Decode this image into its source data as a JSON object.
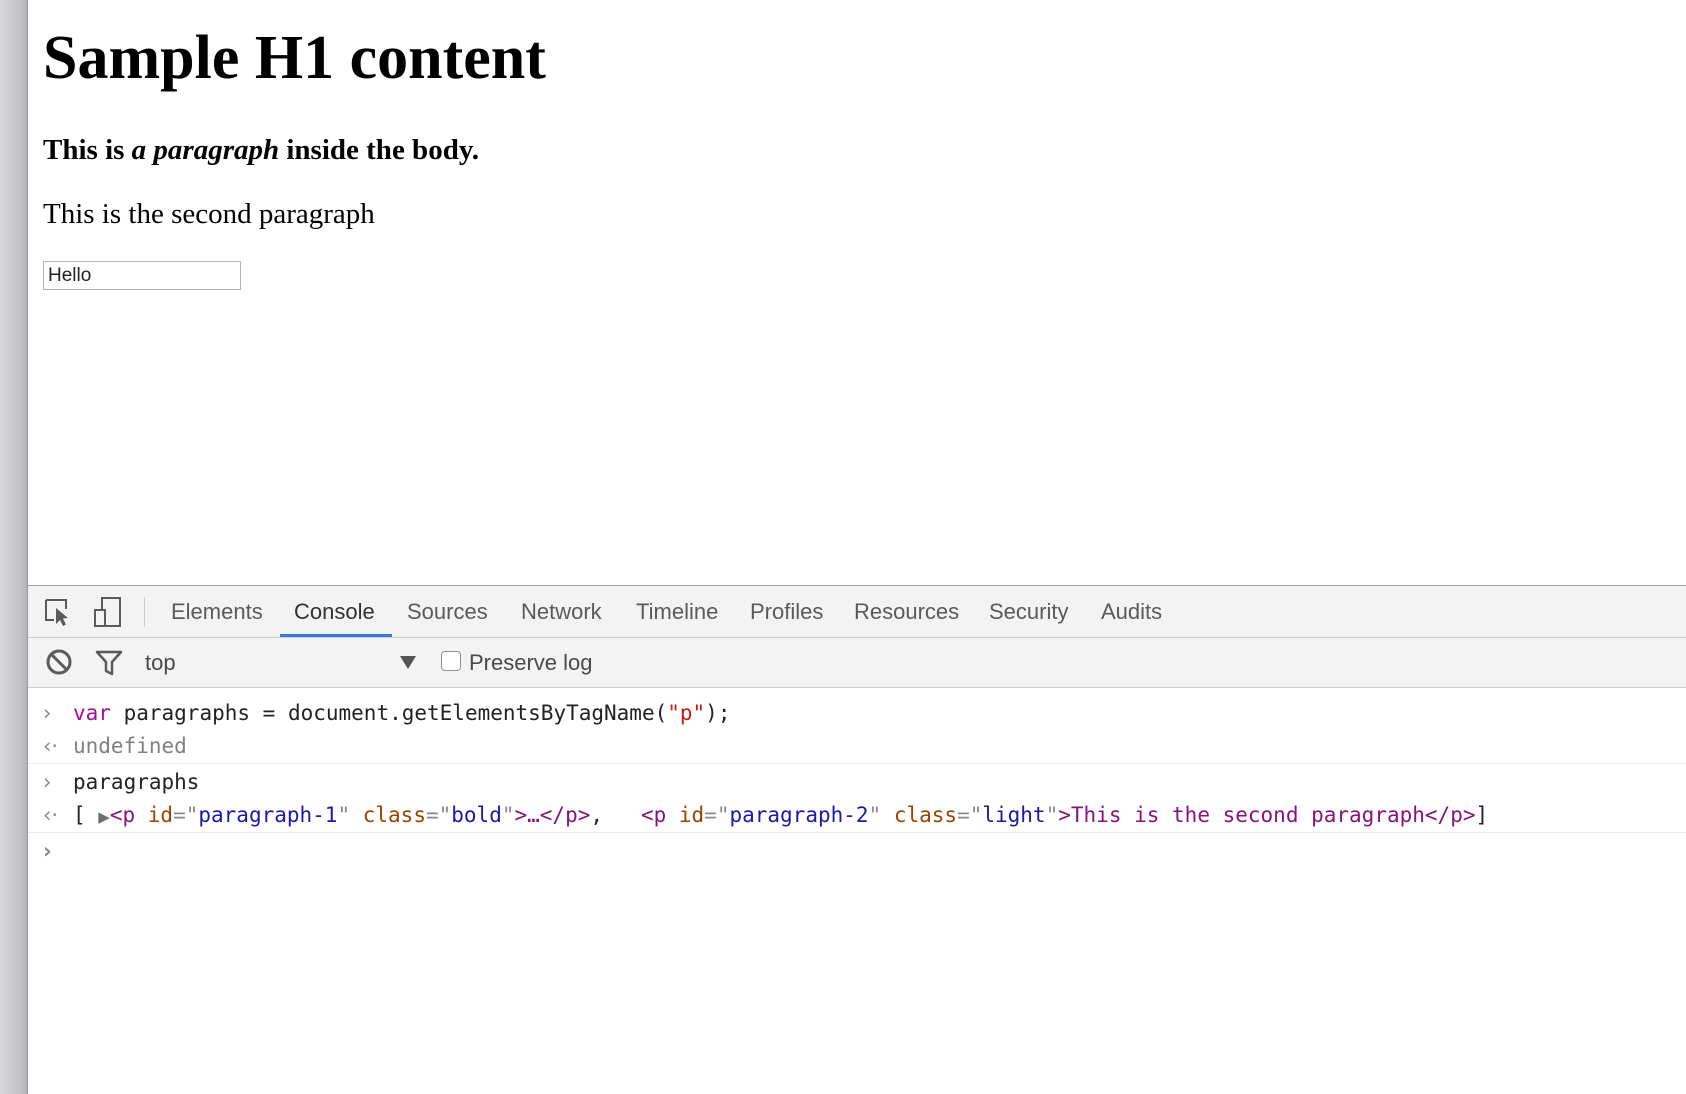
{
  "page": {
    "heading": "Sample H1 content",
    "para1": {
      "before": "This is ",
      "em": "a paragraph",
      "after": " inside the body."
    },
    "para2": "This is the second paragraph",
    "input_value": "Hello"
  },
  "devtools": {
    "tabs": [
      "Elements",
      "Console",
      "Sources",
      "Network",
      "Timeline",
      "Profiles",
      "Resources",
      "Security",
      "Audits"
    ],
    "active_tab": "Console",
    "toolbar": {
      "context": "top",
      "preserve_log_label": "Preserve log",
      "preserve_log_checked": false
    },
    "console": {
      "line1": {
        "kw": "var",
        "rest": " paragraphs = document.getElementsByTagName(",
        "str": "\"p\"",
        "end": ");"
      },
      "line2": "undefined",
      "line3": "paragraphs",
      "line4": {
        "open": "[ ",
        "p1_tag_open": "<p",
        "p1_attr_id": " id",
        "p1_eq1": "=\"",
        "p1_id_val": "paragraph-1",
        "p1_q1": "\"",
        "p1_attr_class": " class",
        "p1_eq2": "=\"",
        "p1_class_val": "bold",
        "p1_q2": "\"",
        "p1_close": ">…</p>",
        "comma": ",   ",
        "p2_tag_open": "<p",
        "p2_attr_id": " id",
        "p2_eq1": "=\"",
        "p2_id_val": "paragraph-2",
        "p2_q1": "\"",
        "p2_attr_class": " class",
        "p2_eq2": "=\"",
        "p2_class_val": "light",
        "p2_q2": "\"",
        "p2_gt": ">",
        "p2_text": "This is the second paragraph",
        "p2_end": "</p>",
        "close": "]"
      }
    },
    "icons": {
      "inspect": "inspect-element-icon",
      "device": "device-mode-icon",
      "clear": "clear-console-icon",
      "filter": "filter-icon"
    }
  }
}
